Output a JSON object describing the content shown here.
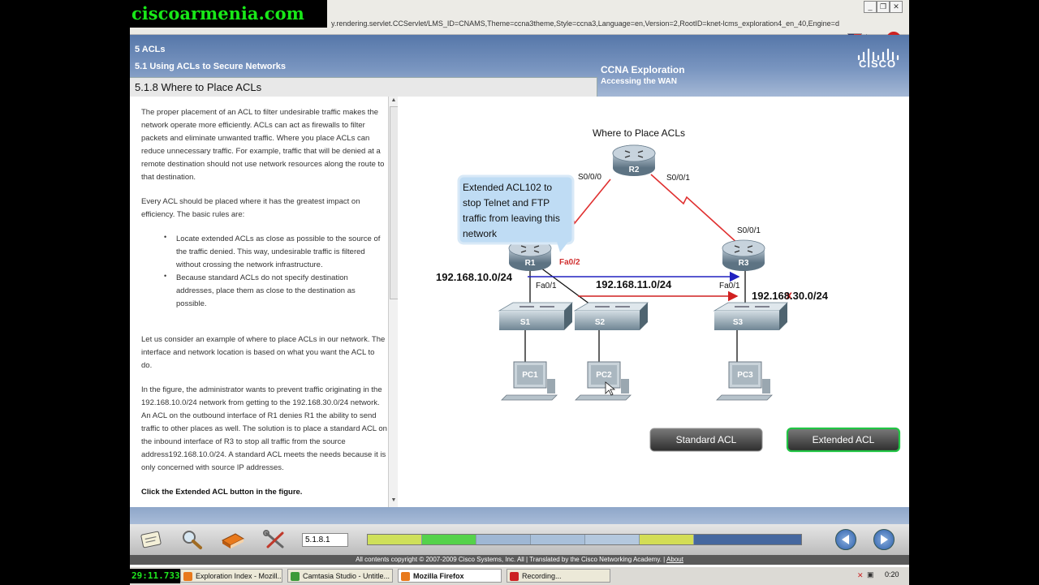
{
  "watermark": "ciscoarmenia.com",
  "browser": {
    "url": "y.rendering.servlet.CCServlet/LMS_ID=CNAMS,Theme=ccna3theme,Style=ccna3,Language=en,Version=2,RootID=knet-lcms_exploration4_en_40,Engine=d"
  },
  "header": {
    "chapter": "5 ACLs",
    "section": "5.1 Using ACLs to Secure Networks",
    "page_title": "5.1.8 Where to Place ACLs",
    "course": "CCNA Exploration",
    "course_sub": "Accessing the WAN",
    "logo_text": "CISCO"
  },
  "content": {
    "p1": "The proper placement of an ACL to filter undesirable traffic makes the network operate more efficiently. ACLs can act as firewalls to filter packets and eliminate unwanted traffic. Where you place ACLs can reduce unnecessary traffic. For example, traffic that will be denied at a remote destination should not use network resources along the route to that destination.",
    "p2": "Every ACL should be placed where it has the greatest impact on efficiency. The basic rules are:",
    "bullet1": "Locate extended ACLs as close as possible to the source of the traffic denied. This way, undesirable traffic is filtered without crossing the network infrastructure.",
    "bullet2": "Because standard ACLs do not specify destination addresses, place them as close to the destination as possible.",
    "p3": "Let us consider an example of where to place ACLs in our network. The interface and network location is based on what you want the ACL to do.",
    "p4": "In the figure, the administrator wants to prevent traffic originating in the 192.168.10.0/24 network from getting to the 192.168.30.0/24 network. An ACL on the outbound interface of R1 denies R1 the ability to send traffic to other places as well. The solution is to place a standard ACL on the inbound interface of R3 to stop all traffic from the source address192.168.10.0/24. A standard ACL meets the needs because it is only concerned with source IP addresses.",
    "p5": "Click the Extended ACL button in the figure."
  },
  "diagram": {
    "title": "Where to Place ACLs",
    "callout": "Extended ACL102  to stop Telnet and FTP traffic from leaving this network",
    "routers": {
      "r1": "R1",
      "r2": "R2",
      "r3": "R3"
    },
    "switches": {
      "s1": "S1",
      "s2": "S2",
      "s3": "S3"
    },
    "pcs": {
      "pc1": "PC1",
      "pc2": "PC2",
      "pc3": "PC3"
    },
    "interfaces": {
      "r2_left": "S0/0/0",
      "r2_right": "S0/0/1",
      "r3_serial": "S0/0/1",
      "r1_fa02": "Fa0/2",
      "r1_fa01": "Fa0/1",
      "r3_fa01": "Fa0/1"
    },
    "networks": {
      "net10": "192.168.10.0/24",
      "net11": "192.168.11.0/24",
      "net30": "192.168.30.0/24"
    },
    "deny_mark": "X",
    "buttons": {
      "standard": "Standard ACL",
      "extended": "Extended ACL"
    },
    "colors": {
      "serial_link": "#e03030",
      "flow_ok": "#2020c0",
      "flow_denied": "#d02020",
      "active_button": "#21c444"
    }
  },
  "nav": {
    "page_number": "5.1.8.1",
    "progress_colors": [
      "#cfe05a",
      "#55d24a",
      "#9fb7d4",
      "#a9c0da",
      "#b4c8de",
      "#d3dd55",
      "#45679f"
    ]
  },
  "footer": {
    "copyright": "All contents copyright © 2007-2009 Cisco Systems, Inc. All | Translated by the Cisco Networking Academy. |",
    "about": "About"
  },
  "taskbar": {
    "timer": "29:11.733",
    "tasks": [
      "Exploration Index - Mozill...",
      "Camtasia Studio - Untitle...",
      "Mozilla Firefox",
      "Recording..."
    ],
    "clock": "0:20"
  }
}
